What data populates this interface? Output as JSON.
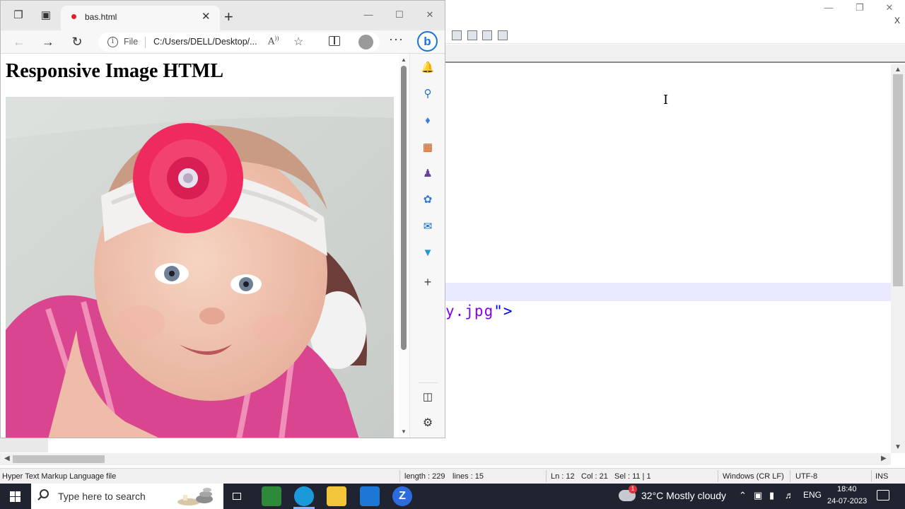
{
  "browser": {
    "tab_title": "bas.html",
    "file_label": "File",
    "url": "C:/Users/DELL/Desktop/...",
    "readaloud_label": "A",
    "page_heading": "Responsive Image HTML"
  },
  "editor": {
    "code_fragment": "y.jpg",
    "code_close": "\">",
    "close_mark": "X",
    "status": {
      "file_type": "Hyper Text Markup Language file",
      "length": "length : 229",
      "lines": "lines : 15",
      "ln": "Ln : 12",
      "col": "Col : 21",
      "sel": "Sel : 11 | 1",
      "eol": "Windows (CR LF)",
      "encoding": "UTF-8",
      "mode": "INS"
    }
  },
  "taskbar": {
    "search_placeholder": "Type here to search",
    "weather": "32°C  Mostly cloudy",
    "weather_badge": "1",
    "language": "ENG",
    "time": "18:40",
    "date": "24-07-2023"
  },
  "colors": {
    "edge_accent": "#1a73d8",
    "taskbar_bg": "#1f2430",
    "code_string": "#8000ff",
    "code_tag": "#0000ff",
    "highlight_line": "#e8e8ff"
  }
}
